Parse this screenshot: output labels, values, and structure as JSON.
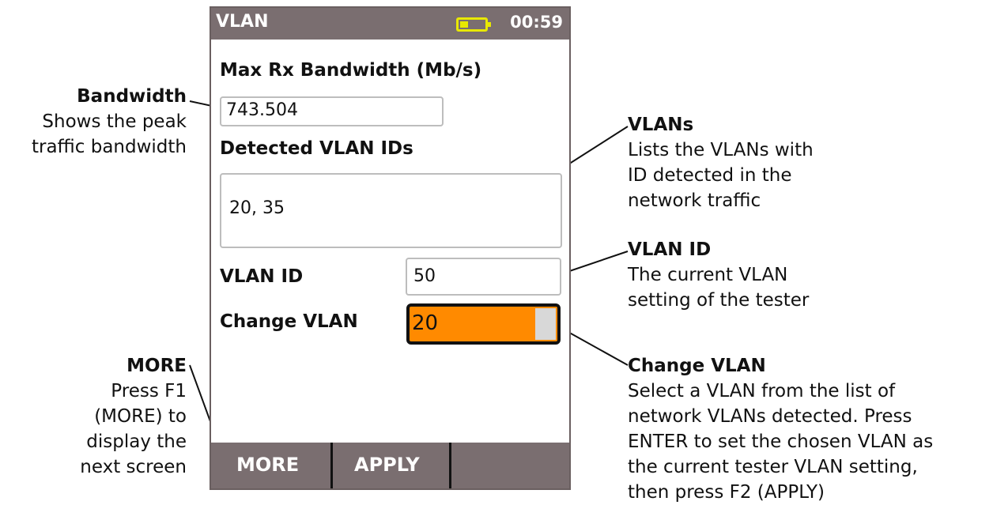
{
  "device": {
    "title": "VLAN",
    "clock": "00:59",
    "max_rx_label": "Max Rx Bandwidth (Mb/s)",
    "max_rx_value": "743.504",
    "detected_label": "Detected VLAN IDs",
    "detected_value": "20, 35",
    "vlan_id_label": "VLAN ID",
    "vlan_id_value": "50",
    "change_vlan_label": "Change VLAN",
    "change_vlan_value": "20",
    "fkeys": [
      "MORE",
      "APPLY",
      ""
    ],
    "colors": {
      "titlebar": "#7a6e70",
      "selected": "#ff8a00",
      "battery": "#e8e800"
    }
  },
  "annotations": {
    "bandwidth": {
      "title": "Bandwidth",
      "lines": [
        "Shows the peak",
        "traffic bandwidth"
      ]
    },
    "vlans": {
      "title": "VLANs",
      "lines": [
        "Lists the VLANs with",
        "ID detected in the",
        "network traffic"
      ]
    },
    "vlan_id": {
      "title": "VLAN ID",
      "lines": [
        "The current VLAN",
        "setting of the tester"
      ]
    },
    "change_vlan": {
      "title": "Change VLAN",
      "lines": [
        "Select a VLAN from the list of",
        "network VLANs detected. Press",
        "ENTER to set the chosen VLAN as",
        "the current tester VLAN setting,",
        "then press F2 (APPLY)"
      ]
    },
    "more": {
      "title": "MORE",
      "lines": [
        "Press F1",
        "(MORE) to",
        "display the",
        "next screen"
      ]
    }
  }
}
